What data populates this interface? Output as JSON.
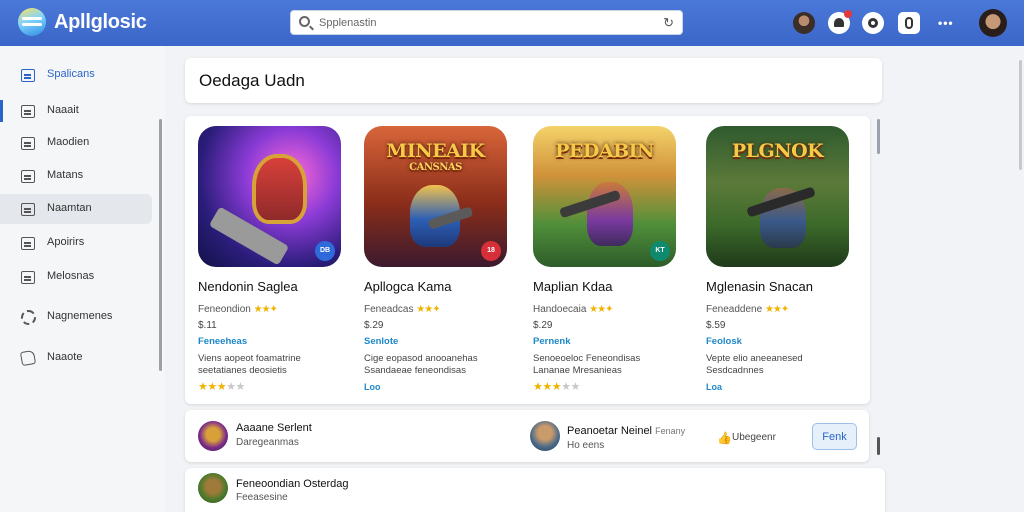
{
  "app": {
    "title": "Apllglosic"
  },
  "search": {
    "placeholder": "Spplenastin",
    "value": "Spplenastin",
    "refresh_icon": "refresh-icon"
  },
  "toolbar": {
    "icons": [
      "avatar",
      "bell-icon",
      "circle-icon",
      "lock-icon",
      "more-icon",
      "profile-avatar"
    ],
    "more": "•••"
  },
  "sidebar": {
    "items": [
      {
        "label": "Spalicans",
        "icon": "apps-icon",
        "active": true
      },
      {
        "label": "Naaait",
        "icon": "doc-icon"
      },
      {
        "label": "Maodien",
        "icon": "doc-icon"
      },
      {
        "label": "Matans",
        "icon": "doc-icon"
      },
      {
        "label": "Naamtan",
        "icon": "doc-icon",
        "selected": true
      },
      {
        "label": "Apoirirs",
        "icon": "doc-icon"
      },
      {
        "label": "Melosnas",
        "icon": "doc-icon"
      },
      {
        "label": "Nagnemenes",
        "icon": "gear-icon"
      },
      {
        "label": "Naaote",
        "icon": "home-icon"
      }
    ]
  },
  "main": {
    "page_title": "Oedaga Uadn",
    "apps": [
      {
        "name": "Nendonin Saglea",
        "developer": "Feneondion",
        "stars_text": "★★✦",
        "price": "$.11",
        "category": "Feneeheas",
        "description": "Viens aopeot foamatrine seetatianes deosietis",
        "rating_on": "★★★",
        "rating_off": "★★",
        "thumb_title": "",
        "thumb_subtitle": "",
        "badge": "DB",
        "badge_color": "#2e6ad9"
      },
      {
        "name": "Apllogca Kama",
        "developer": "Feneadcas",
        "stars_text": "★★✦",
        "price": "$.29",
        "category": "Senlote",
        "description": "Cige eopasod anooanehas Ssandaeae feneondisas",
        "more": "Loo",
        "thumb_title": "MINEAIK",
        "thumb_subtitle": "CANSNAS",
        "badge": "18",
        "badge_color": "#d62f3a"
      },
      {
        "name": "Maplian Kdaa",
        "developer": "Handoecaia",
        "stars_text": "★★✦",
        "price": "$.29",
        "category": "Pernenk",
        "description": "Senoeoeloc Feneondisas Lananae Mresanieas",
        "rating_on": "★★★",
        "rating_off": "★★",
        "thumb_title": "PEDABIN",
        "thumb_subtitle": "",
        "badge": "KT",
        "badge_color": "#0e8a6e"
      },
      {
        "name": "Mglenasin Snacan",
        "developer": "Feneaddene",
        "stars_text": "★★✦",
        "price": "$.59",
        "category": "Feolosk",
        "description": "Vepte elio aneeanesed Sesdcadnnes",
        "more": "Loa",
        "thumb_title": "PLGNOK",
        "thumb_subtitle": "",
        "badge": "",
        "badge_color": ""
      }
    ],
    "rows": [
      {
        "left_title": "Aaaane Serlent",
        "left_sub": "Daregeanmas",
        "mid_title": "Peanoetar Neinel",
        "mid_extra": "Fenany",
        "mid_sub": "Ho eens",
        "like_text": "Ubegeenr",
        "button": "Fenk"
      },
      {
        "left_title": "Feneoondian Osterdag",
        "left_sub": "Feeasesine"
      }
    ]
  },
  "colors": {
    "topbar": "#3b66c9",
    "accent": "#2a64c9",
    "link": "#1e88c9",
    "star": "#f0b400"
  }
}
